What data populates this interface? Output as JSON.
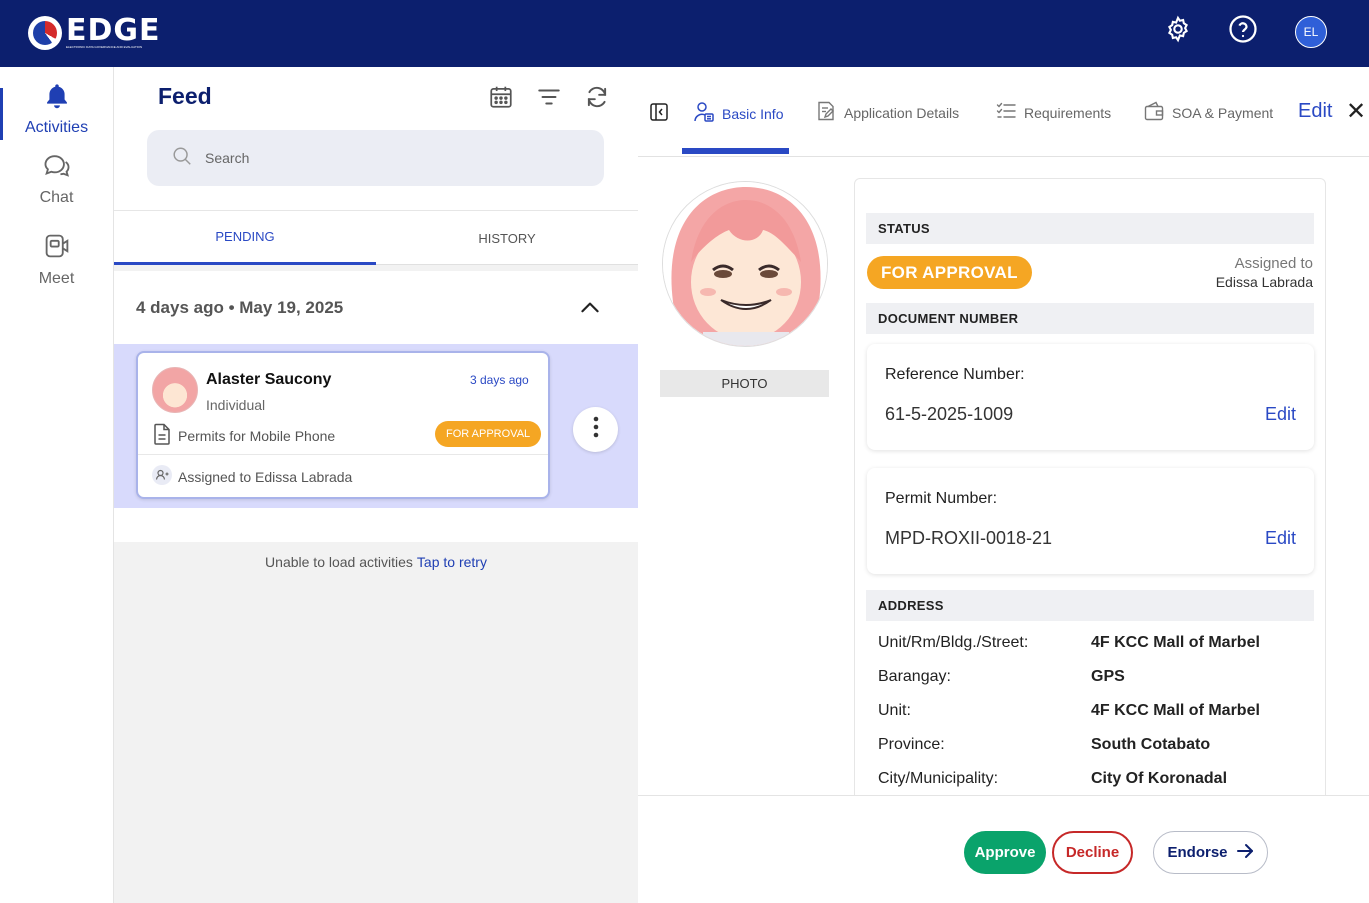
{
  "app": {
    "logo_text": "EDGE",
    "logo_subtitle": "ELECTRONIC DATA GOVERNANCE AND EVALUATION",
    "user_initials": "EL"
  },
  "nav": {
    "items": [
      {
        "label": "Activities",
        "icon": "bell-icon",
        "active": true
      },
      {
        "label": "Chat",
        "icon": "chat-icon"
      },
      {
        "label": "Meet",
        "icon": "video-icon"
      }
    ]
  },
  "feed": {
    "title": "Feed",
    "search_placeholder": "Search",
    "tabs": [
      {
        "label": "PENDING",
        "active": true
      },
      {
        "label": "HISTORY"
      }
    ],
    "group": {
      "label": "4 days ago • May 19, 2025"
    },
    "card": {
      "name": "Alaster Saucony",
      "time": "3 days ago",
      "type": "Individual",
      "document": "Permits for Mobile Phone",
      "status": "FOR APPROVAL",
      "assigned": "Assigned to Edissa Labrada"
    },
    "error_text": "Unable to load activities",
    "retry_text": "Tap to retry"
  },
  "detail": {
    "tabs": [
      {
        "label": "Basic Info",
        "active": true
      },
      {
        "label": "Application Details"
      },
      {
        "label": "Requirements"
      },
      {
        "label": "SOA & Payment"
      }
    ],
    "edit_label": "Edit",
    "photo_label": "PHOTO",
    "status": {
      "section": "STATUS",
      "badge": "FOR APPROVAL",
      "assigned_label": "Assigned to",
      "assigned_name": "Edissa Labrada"
    },
    "document": {
      "section": "DOCUMENT NUMBER",
      "reference_label": "Reference Number:",
      "reference_value": "61-5-2025-1009",
      "permit_label": "Permit Number:",
      "permit_value": "MPD-ROXII-0018-21",
      "edit_label": "Edit"
    },
    "address": {
      "section": "ADDRESS",
      "rows": [
        {
          "key": "Unit/Rm/Bldg./Street:",
          "value": "4F KCC Mall of Marbel"
        },
        {
          "key": "Barangay:",
          "value": "GPS"
        },
        {
          "key": "Unit:",
          "value": "4F KCC Mall of Marbel"
        },
        {
          "key": "Province:",
          "value": "South Cotabato"
        },
        {
          "key": "City/Municipality:",
          "value": "City Of Koronadal"
        }
      ]
    },
    "actions": {
      "approve": "Approve",
      "decline": "Decline",
      "endorse": "Endorse"
    }
  },
  "colors": {
    "topbar": "#0c1f6e",
    "accent": "#2a49c4",
    "status_approval": "#f5a623",
    "approve": "#0aa36b",
    "decline": "#c62828",
    "selected_card_bg": "#d8dafc"
  }
}
